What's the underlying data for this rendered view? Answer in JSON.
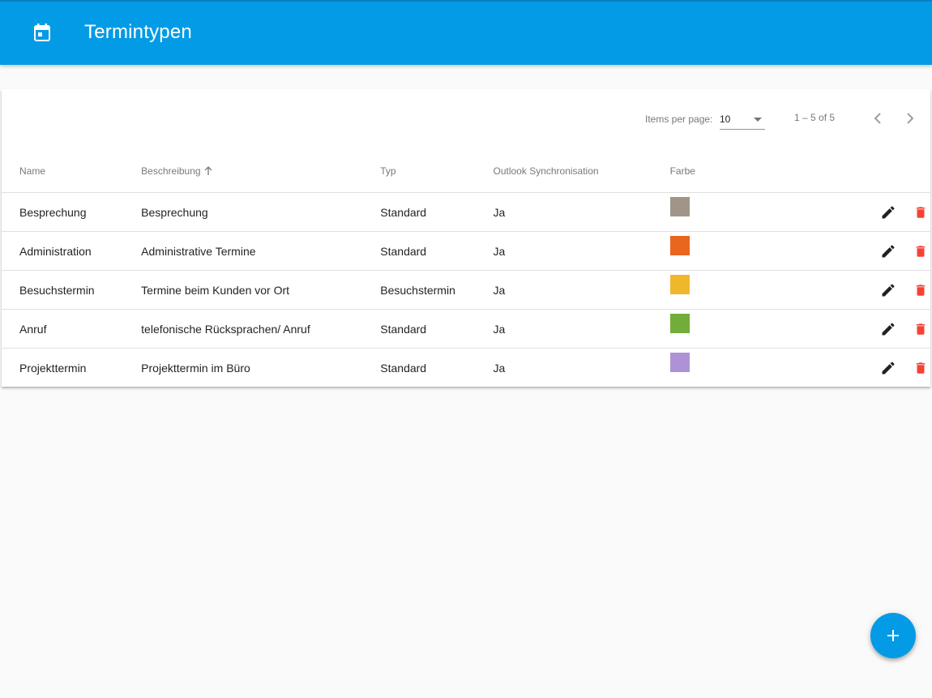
{
  "header": {
    "title": "Termintypen",
    "icon": "calendar-icon",
    "background": "#039be5"
  },
  "paginator": {
    "items_per_page_label": "Items per page:",
    "page_size": "10",
    "range_label": "1 – 5 of 5"
  },
  "table": {
    "columns": {
      "name": "Name",
      "description": "Beschreibung",
      "type": "Typ",
      "sync": "Outlook Synchronisation",
      "color": "Farbe"
    },
    "sorted_column": "Beschreibung",
    "sort_direction": "ascending",
    "rows": [
      {
        "name": "Besprechung",
        "description": "Besprechung",
        "type": "Standard",
        "sync": "Ja",
        "color": "#a09588"
      },
      {
        "name": "Administration",
        "description": "Administrative Termine",
        "type": "Standard",
        "sync": "Ja",
        "color": "#e8661e"
      },
      {
        "name": "Besuchstermin",
        "description": "Termine beim Kunden vor Ort",
        "type": "Besuchstermin",
        "sync": "Ja",
        "color": "#f0b72b"
      },
      {
        "name": "Anruf",
        "description": "telefonische Rücksprachen/ Anruf",
        "type": "Standard",
        "sync": "Ja",
        "color": "#72ac3a"
      },
      {
        "name": "Projekttermin",
        "description": "Projekttermin im Büro",
        "type": "Standard",
        "sync": "Ja",
        "color": "#ad92d8"
      }
    ]
  },
  "colors": {
    "edit_icon": "#212121",
    "delete_icon": "#f44336",
    "fab": "#039be5"
  }
}
